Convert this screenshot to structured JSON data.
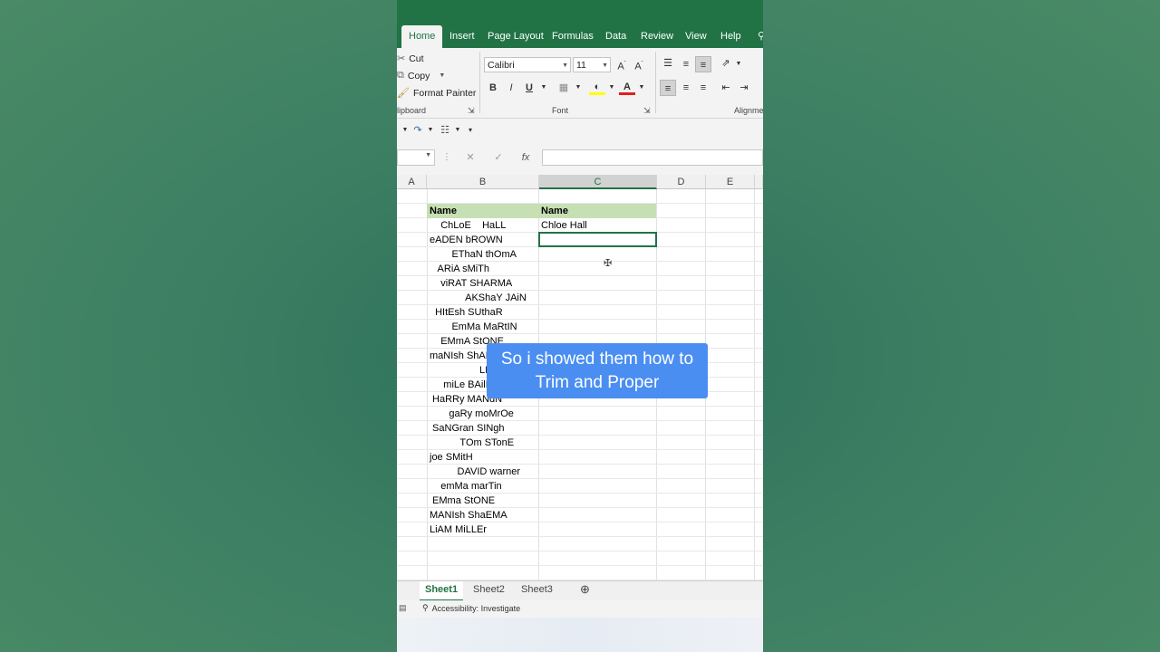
{
  "ribbon": {
    "tabs": [
      "Home",
      "Insert",
      "Page Layout",
      "Formulas",
      "Data",
      "Review",
      "View",
      "Help"
    ],
    "clipboard": {
      "cut": "Cut",
      "copy": "Copy",
      "format_painter": "Format Painter",
      "label": "lipboard"
    },
    "font": {
      "name": "Calibri",
      "size": "11",
      "label": "Font",
      "bold": "B",
      "italic": "I",
      "underline": "U"
    },
    "alignment": {
      "label": "Alignme"
    }
  },
  "formula_bar": {
    "fx": "fx"
  },
  "columns": [
    "A",
    "B",
    "C",
    "D",
    "E"
  ],
  "sheet": {
    "header_b": "Name",
    "header_c": "Name",
    "names": [
      "    ChLoE    HaLL",
      "eADEN bROWN",
      "        EThaN thOmA",
      "   ARiA sMiTh",
      "    viRAT SHARMA",
      "             AKShaY JAiN",
      "  HItEsh SUthaR",
      "        EmMa MaRtIN",
      "    EMmA StONE",
      "maNIsh ShAEMA",
      "                  LIAM",
      "     miLe BAilEY",
      " HaRRy MANdN",
      "       gaRy moMrOe",
      " SaNGran SINgh",
      "           TOm STonE",
      "joe SMitH",
      "          DAVID warner",
      "    emMa marTin",
      " EMma StONE",
      "MANIsh ShaEMA",
      "LiAM MiLLEr"
    ],
    "c2_value": "Chloe Hall"
  },
  "sheet_tabs": [
    "Sheet1",
    "Sheet2",
    "Sheet3"
  ],
  "status": {
    "accessibility": "Accessibility: Investigate"
  },
  "caption": {
    "line1": "So i showed them how to",
    "line2": "Trim and Proper"
  }
}
